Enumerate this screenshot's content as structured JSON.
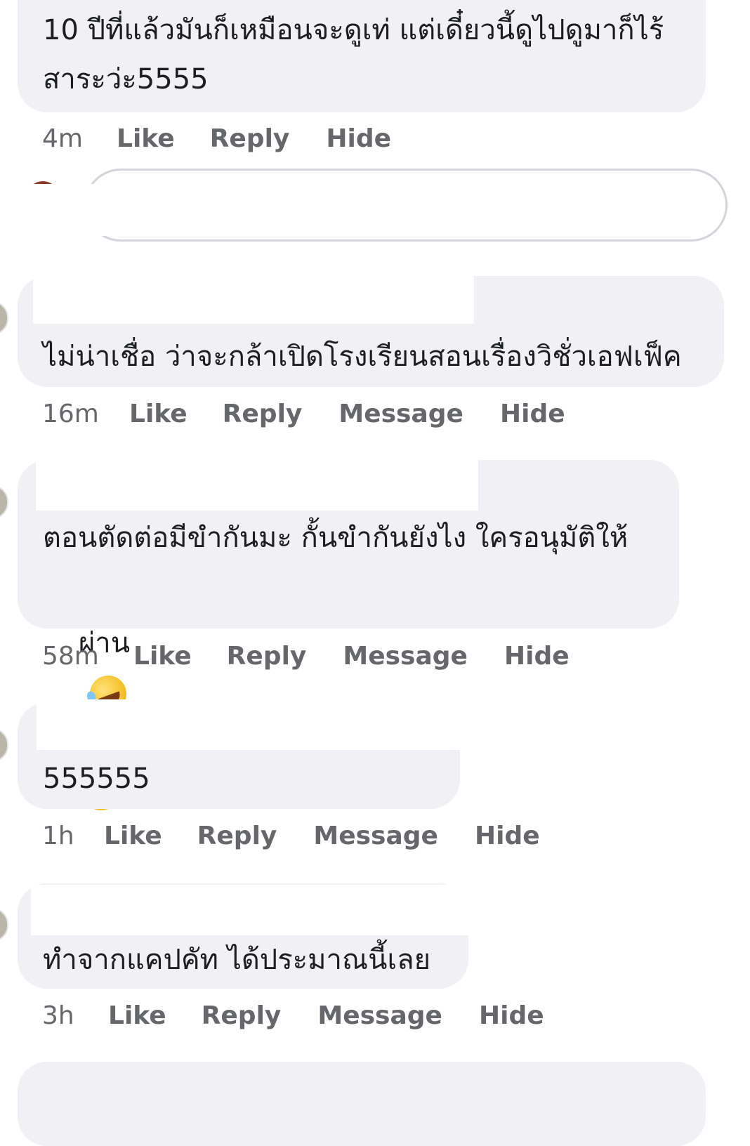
{
  "comments": [
    {
      "text_line1": "10 ปีที่แล้วมันก็เหมือนจะดูเท่ แต่เดี๋ยวนี้ดูไปดูมาก็ไร้",
      "text_line2": "สาระว่ะ5555",
      "time": "4m",
      "actions": [
        "Like",
        "Reply",
        "Hide"
      ]
    },
    {
      "text_line1": "ไม่น่าเชื่อ ว่าจะกล้าเปิดโรงเรียนสอนเรื่องวิชั่วเอฟเฟ็ค",
      "time": "16m",
      "actions": [
        "Like",
        "Reply",
        "Message",
        "Hide"
      ]
    },
    {
      "text_line1": "ตอนตัดต่อมีขำกันมะ กั้นขำกันยังไง ใครอนุมัติให้",
      "text_line2": "ผ่าน",
      "emojis": [
        "rolling-on-floor-laughing",
        "rolling-on-floor-laughing",
        "rolling-on-floor-laughing"
      ],
      "time": "58m",
      "actions": [
        "Like",
        "Reply",
        "Message",
        "Hide"
      ]
    },
    {
      "text_line1": "555555",
      "time": "1h",
      "actions": [
        "Like",
        "Reply",
        "Message",
        "Hide"
      ]
    },
    {
      "text_line1": "ทำจากแคปคัท ได้ประมาณนี้เลย",
      "time": "3h",
      "actions": [
        "Like",
        "Reply",
        "Message",
        "Hide"
      ]
    }
  ],
  "colors": {
    "bubble": "#f0f0f5",
    "action_text": "#65676b",
    "comment_text": "#1c1e21"
  }
}
